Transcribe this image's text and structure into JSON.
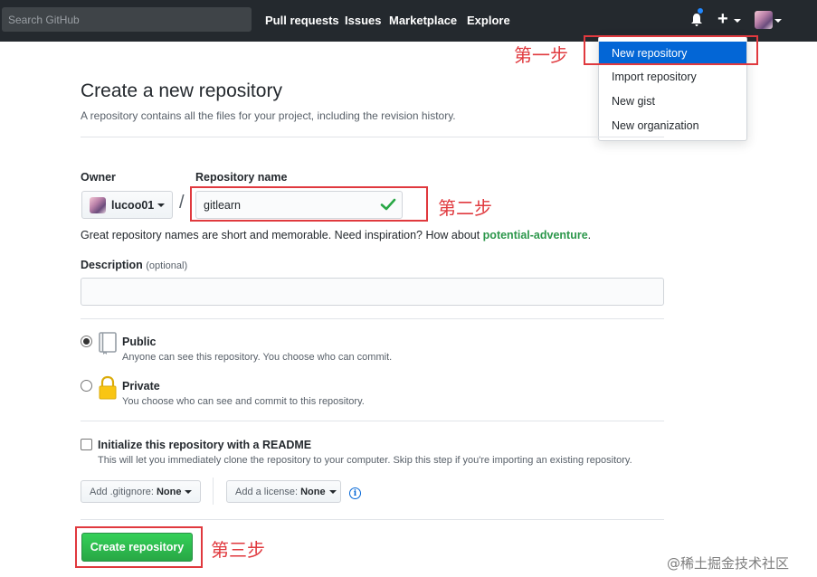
{
  "header": {
    "search_placeholder": "Search GitHub",
    "nav": [
      "Pull requests",
      "Issues",
      "Marketplace",
      "Explore"
    ],
    "plus_label": "+"
  },
  "dropdown": {
    "items": [
      "New repository",
      "Import repository",
      "New gist",
      "New organization"
    ],
    "active_index": 0
  },
  "annotations": {
    "step1": "第一步",
    "step2": "第二步",
    "step3": "第三步"
  },
  "page": {
    "title": "Create a new repository",
    "subtitle": "A repository contains all the files for your project, including the revision history."
  },
  "form": {
    "owner_label": "Owner",
    "owner_value": "lucoo01",
    "slash": "/",
    "repo_label": "Repository name",
    "repo_value": "gitlearn",
    "hint_prefix": "Great repository names are short and memorable. Need inspiration? How about ",
    "hint_suggestion": "potential-adventure",
    "hint_suffix": ".",
    "description_label": "Description",
    "description_optional": "(optional)",
    "description_value": "",
    "visibility": {
      "selected": "public",
      "public_title": "Public",
      "public_desc": "Anyone can see this repository. You choose who can commit.",
      "private_title": "Private",
      "private_desc": "You choose who can see and commit to this repository."
    },
    "readme_title": "Initialize this repository with a README",
    "readme_desc": "This will let you immediately clone the repository to your computer. Skip this step if you're importing an existing repository.",
    "readme_checked": false,
    "gitignore_label": "Add .gitignore:",
    "gitignore_value": "None",
    "license_label": "Add a license:",
    "license_value": "None",
    "info_glyph": "i",
    "submit_label": "Create repository"
  },
  "watermark": "@稀土掘金技术社区",
  "colors": {
    "header_bg": "#24292e",
    "accent_blue": "#0366d6",
    "annotation_red": "#e0393e",
    "success_green": "#28a745"
  }
}
